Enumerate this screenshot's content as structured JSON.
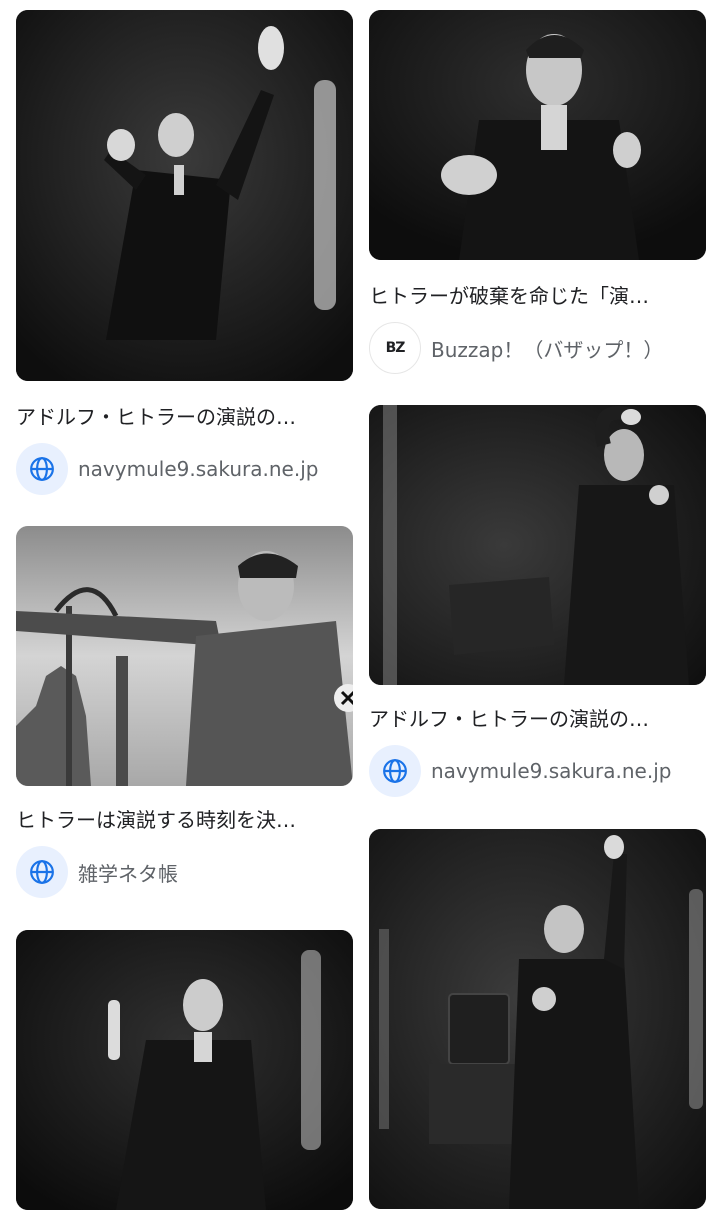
{
  "results": [
    {
      "title": "アドルフ・ヒトラーの演説の…",
      "source": "navymule9.sakura.ne.jp",
      "icon": "globe-icon"
    },
    {
      "title": "ヒトラーが破棄を命じた「演…",
      "source": "Buzzap！（バザップ！）",
      "icon": "buzzap-logo",
      "logo_text": "BZ"
    },
    {
      "title": "ヒトラーは演説する時刻を決…",
      "source": "雑学ネタ帳",
      "icon": "globe-icon"
    },
    {
      "title": "アドルフ・ヒトラーの演説の…",
      "source": "navymule9.sakura.ne.jp",
      "icon": "globe-icon"
    }
  ],
  "colors": {
    "globe": "#1a73e8",
    "globe_bg": "#e8f0fe",
    "title_text": "#202124",
    "source_text": "#5f6368",
    "buzzap_red": "#d93025"
  }
}
